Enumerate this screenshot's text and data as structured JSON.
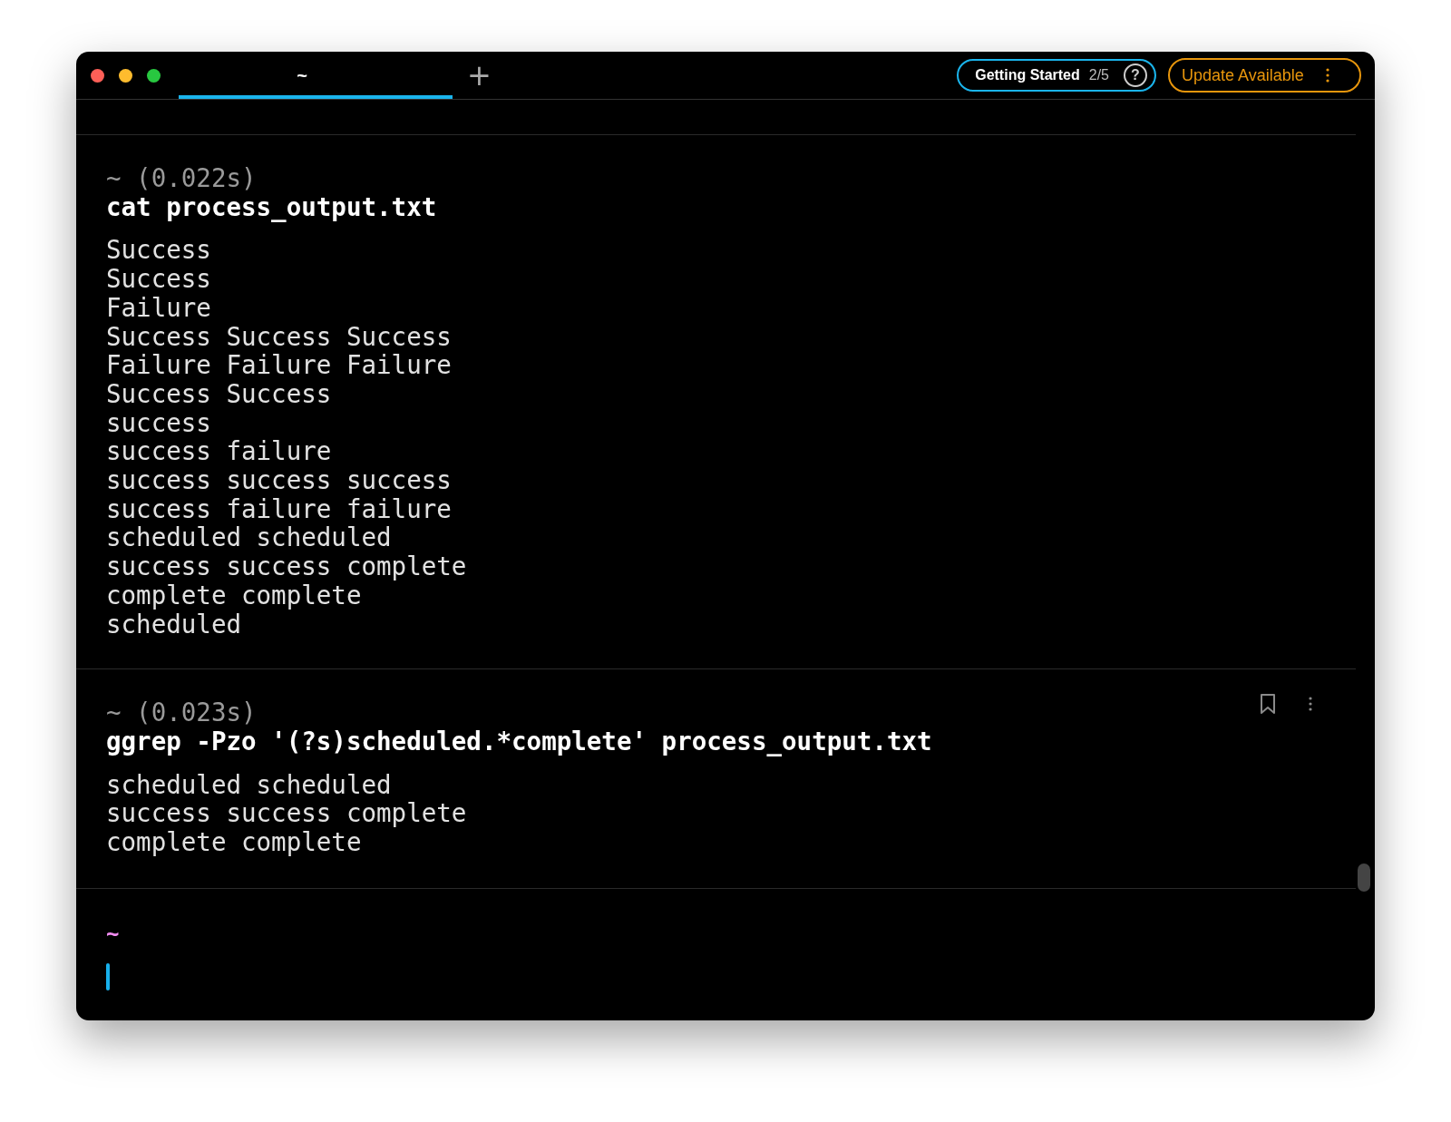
{
  "tabs": [
    {
      "label": "~",
      "selected": true
    }
  ],
  "new_tab": {
    "label": "+"
  },
  "getting_started": {
    "label": "Getting Started",
    "progress": "2/5",
    "help": "?"
  },
  "update_button": {
    "label": "Update Available"
  },
  "blocks": [
    {
      "header": "~ (0.022s)",
      "command": "cat process_output.txt",
      "show_actions": false,
      "output": [
        "Success",
        "Success",
        "Failure",
        "Success Success Success",
        "Failure Failure Failure",
        "Success Success",
        "success",
        "success failure",
        "success success success",
        "success failure failure",
        "scheduled scheduled",
        "success success complete",
        "complete complete",
        "scheduled"
      ]
    },
    {
      "header": "~ (0.023s)",
      "command": "ggrep -Pzo '(?s)scheduled.*complete' process_output.txt",
      "show_actions": true,
      "output": [
        "scheduled scheduled",
        "success success complete",
        "complete complete"
      ]
    }
  ],
  "prompt": {
    "directory": "~"
  }
}
